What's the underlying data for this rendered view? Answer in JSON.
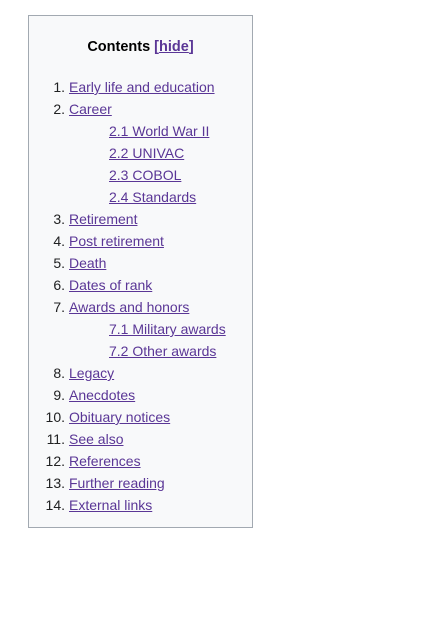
{
  "toc": {
    "title": "Contents",
    "hide_open": " [",
    "hide_label": "hide",
    "hide_close": "]",
    "items": [
      {
        "num": "1.",
        "label": "Early life and education"
      },
      {
        "num": "2.",
        "label": "Career",
        "subitems": [
          {
            "label": "2.1 World War II"
          },
          {
            "label": "2.2 UNIVAC"
          },
          {
            "label": "2.3 COBOL"
          },
          {
            "label": "2.4 Standards"
          }
        ]
      },
      {
        "num": "3.",
        "label": "Retirement"
      },
      {
        "num": "4.",
        "label": "Post retirement"
      },
      {
        "num": "5.",
        "label": "Death"
      },
      {
        "num": "6.",
        "label": "Dates of rank"
      },
      {
        "num": "7.",
        "label": "Awards and honors",
        "subitems": [
          {
            "label": "7.1 Military awards"
          },
          {
            "label": "7.2 Other awards"
          }
        ]
      },
      {
        "num": "8.",
        "label": "Legacy"
      },
      {
        "num": "9.",
        "label": "Anecdotes"
      },
      {
        "num": "10.",
        "label": "Obituary notices"
      },
      {
        "num": "11.",
        "label": "See also"
      },
      {
        "num": "12.",
        "label": "References"
      },
      {
        "num": "13.",
        "label": "Further reading"
      },
      {
        "num": "14.",
        "label": "External links"
      }
    ]
  },
  "colors": {
    "link": "#5a3696",
    "box_background": "#f8f9fa",
    "box_border": "#a2a9b1"
  }
}
